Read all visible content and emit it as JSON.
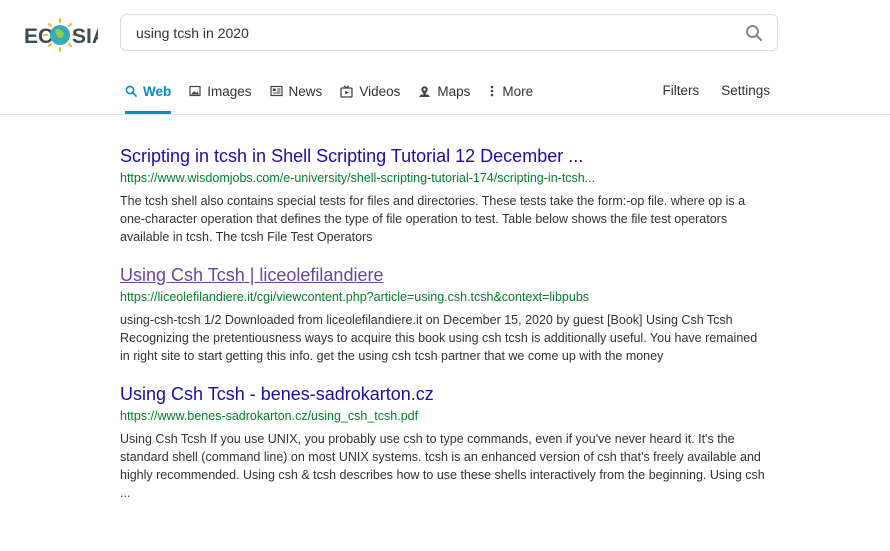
{
  "search": {
    "query": "using tcsh in 2020"
  },
  "logo": {
    "text_left": "EC",
    "text_right": "SIA"
  },
  "nav": {
    "tabs": [
      {
        "label": "Web",
        "icon": "search-icon"
      },
      {
        "label": "Images",
        "icon": "image-icon"
      },
      {
        "label": "News",
        "icon": "newspaper-icon"
      },
      {
        "label": "Videos",
        "icon": "video-icon"
      },
      {
        "label": "Maps",
        "icon": "map-pin-icon"
      },
      {
        "label": "More",
        "icon": "more-vertical-icon"
      }
    ],
    "filters": "Filters",
    "settings": "Settings"
  },
  "colors": {
    "accent": "#008ec9",
    "link": "#1a0dab",
    "visited": "#6b45a0",
    "url": "#04802c"
  },
  "results": [
    {
      "title": "Scripting in tcsh in Shell Scripting Tutorial 12 December ...",
      "url": "https://www.wisdomjobs.com/e-university/shell-scripting-tutorial-174/scripting-in-tcsh...",
      "desc": "The tcsh shell also contains special tests for files and directories. These tests take the form:-op file. where op is a one-character operation that defines the type of file operation to test. Table below shows the file test operators available in tcsh. The tcsh File Test Operators"
    },
    {
      "title": "Using Csh Tcsh | liceolefilandiere",
      "url": "https://liceolefilandiere.it/cgi/viewcontent.php?article=using.csh.tcsh&context=libpubs",
      "desc": "using-csh-tcsh 1/2 Downloaded from liceolefilandiere.it on December 15, 2020 by guest [Book] Using Csh Tcsh Recognizing the pretentiousness ways to acquire this book using csh tcsh is additionally useful. You have remained in right site to start getting this info. get the using csh tcsh partner that we come up with the money"
    },
    {
      "title": "Using Csh Tcsh - benes-sadrokarton.cz",
      "url": "https://www.benes-sadrokarton.cz/using_csh_tcsh.pdf",
      "desc": "Using Csh Tcsh If you use UNIX, you probably use csh to type commands, even if you've never heard it. It's the standard shell (command line) on most UNIX systems. tcsh is an enhanced version of csh that's freely available and highly recommended. Using csh & tcsh describes how to use these shells interactively from the beginning. Using csh ..."
    }
  ]
}
